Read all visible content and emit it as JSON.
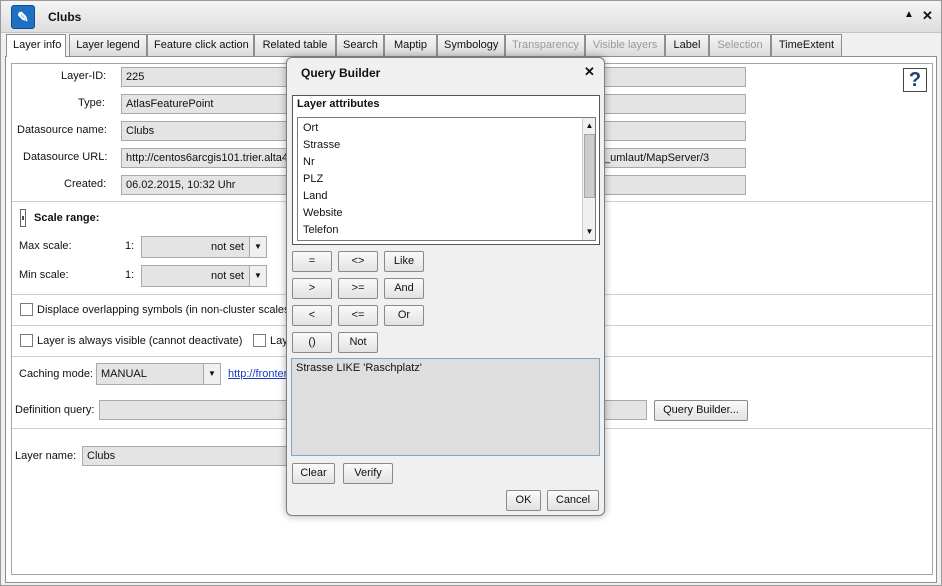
{
  "window": {
    "title": "Clubs",
    "app_icon_glyph": "✎",
    "collapse_glyph": "▲",
    "close_glyph": "✕"
  },
  "tabs": [
    {
      "label": "Layer info",
      "state": "active"
    },
    {
      "label": "Layer legend",
      "state": "normal"
    },
    {
      "label": "Feature click action",
      "state": "normal"
    },
    {
      "label": "Related table",
      "state": "normal"
    },
    {
      "label": "Search",
      "state": "normal"
    },
    {
      "label": "Maptip",
      "state": "normal"
    },
    {
      "label": "Symbology",
      "state": "normal"
    },
    {
      "label": "Transparency",
      "state": "disabled"
    },
    {
      "label": "Visible layers",
      "state": "disabled"
    },
    {
      "label": "Label",
      "state": "normal"
    },
    {
      "label": "Selection",
      "state": "disabled"
    },
    {
      "label": "TimeExtent",
      "state": "normal"
    }
  ],
  "info": {
    "layer_id_label": "Layer-ID:",
    "layer_id_value": "225",
    "type_label": "Type:",
    "type_value": "AtlasFeaturePoint",
    "ds_name_label": "Datasource name:",
    "ds_name_value": "Clubs",
    "ds_url_label": "Datasource URL:",
    "ds_url_value": "http://centos6arcgis101.trier.alta4",
    "ds_url_tail": "_umlaut/MapServer/3",
    "created_label": "Created:",
    "created_value": "06.02.2015, 10:32 Uhr",
    "help_glyph": "?"
  },
  "scale": {
    "heading": "Scale range:",
    "max_label": "Max scale:",
    "min_label": "Min scale:",
    "prefix": "1:",
    "max_value": "not set",
    "min_value": "not set",
    "arrow_glyph": "▼"
  },
  "options": {
    "displace_label": "Displace overlapping symbols (in non-cluster scales",
    "always_visible_label": "Layer is always visible (cannot deactivate)",
    "second_option_partial": "Lay",
    "caching_label": "Caching mode:",
    "caching_value": "MANUAL",
    "caching_link": "http://fronter",
    "defq_label": "Definition query:",
    "query_builder_button": "Query Builder...",
    "layer_name_label": "Layer name:",
    "layer_name_value": "Clubs"
  },
  "dialog": {
    "title": "Query Builder",
    "close_glyph": "✕",
    "attributes_label": "Layer attributes",
    "attributes": [
      "Ort",
      "Strasse",
      "Nr",
      "PLZ",
      "Land",
      "Website",
      "Telefon"
    ],
    "scroll_up_glyph": "▲",
    "scroll_down_glyph": "▼",
    "operators": {
      "eq": "=",
      "neq": "<>",
      "like": "Like",
      "gt": ">",
      "gte": ">=",
      "and": "And",
      "lt": "<",
      "lte": "<=",
      "or": "Or",
      "paren": "()",
      "not": "Not"
    },
    "query_text": "Strasse LIKE 'Raschplatz'",
    "clear_button": "Clear",
    "verify_button": "Verify",
    "ok_button": "OK",
    "cancel_button": "Cancel"
  }
}
